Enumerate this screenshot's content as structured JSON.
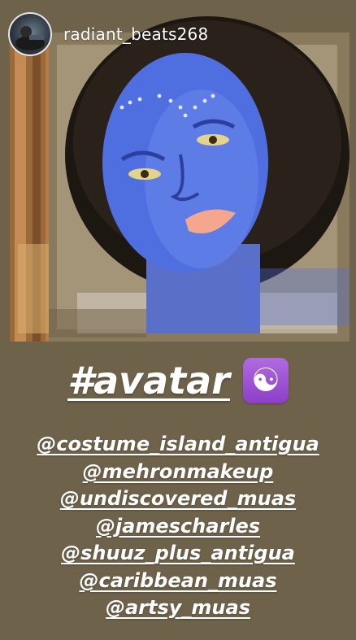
{
  "header": {
    "username": "radiant_beats268"
  },
  "photo": {
    "description_icon": "avatar-photo"
  },
  "caption": {
    "hashtag": "#avatar",
    "emoji": "☯"
  },
  "mentions": [
    "@costume_island_antigua",
    "@mehronmakeup",
    "@undiscovered_muas",
    "@jamescharles",
    "@shuuz_plus_antigua",
    "@caribbean_muas",
    "@artsy_muas"
  ],
  "colors": {
    "background": "#6f624b",
    "skin_blue": "#4f6fe0",
    "emoji_purple": "#9b4fd6",
    "text": "#ffffff"
  }
}
